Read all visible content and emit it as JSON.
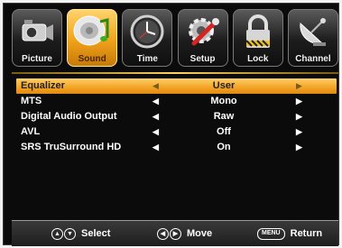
{
  "tabs": [
    {
      "label": "Picture",
      "icon": "camera-icon"
    },
    {
      "label": "Sound",
      "icon": "speaker-music-icon",
      "active": true
    },
    {
      "label": "Time",
      "icon": "clock-icon"
    },
    {
      "label": "Setup",
      "icon": "wrench-gear-icon"
    },
    {
      "label": "Lock",
      "icon": "padlock-icon"
    },
    {
      "label": "Channel",
      "icon": "satellite-dish-icon"
    }
  ],
  "menu": [
    {
      "label": "Equalizer",
      "value": "User",
      "selected": true
    },
    {
      "label": "MTS",
      "value": "Mono"
    },
    {
      "label": "Digital Audio Output",
      "value": "Raw"
    },
    {
      "label": "AVL",
      "value": "Off"
    },
    {
      "label": "SRS TruSurround HD",
      "value": "On"
    }
  ],
  "footer": {
    "select": "Select",
    "move": "Move",
    "menu_key": "MENU",
    "return": "Return"
  },
  "colors": {
    "accent": "#f2a323",
    "background": "#0b0b0b"
  }
}
